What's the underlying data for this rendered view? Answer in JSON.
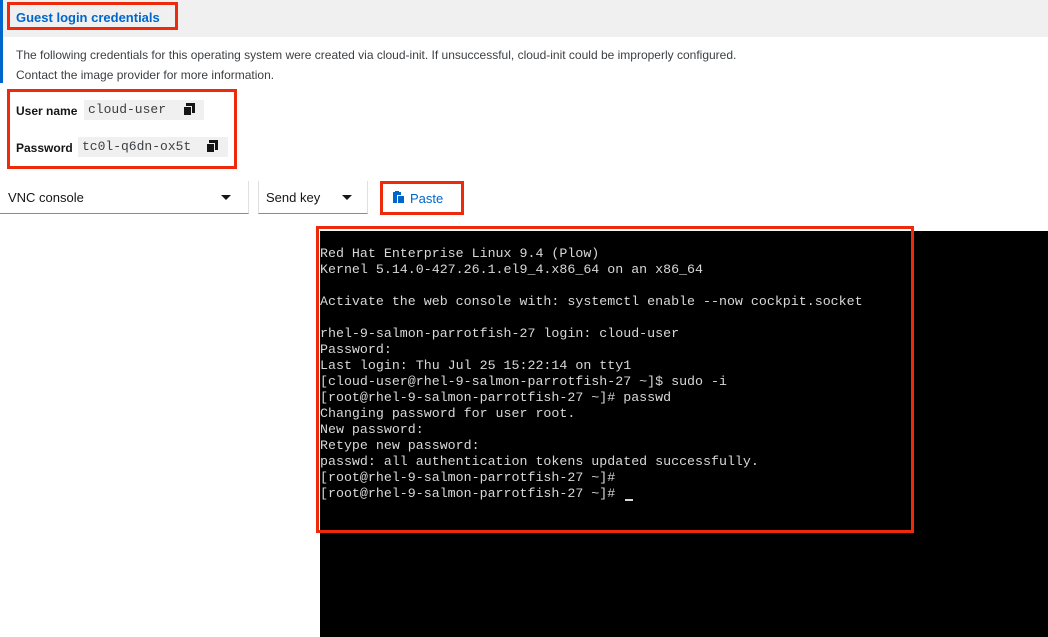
{
  "credentials": {
    "title": "Guest login credentials",
    "description_line1": "The following credentials for this operating system were created via cloud-init. If unsuccessful, cloud-init could be improperly configured.",
    "description_line2": "Contact the image provider for more information.",
    "username_label": "User name",
    "username_value": "cloud-user",
    "password_label": "Password",
    "password_value": "tc0l-q6dn-ox5t",
    "copy_icon": "copy-icon"
  },
  "toolbar": {
    "console_type_selected": "VNC console",
    "send_key_label": "Send key",
    "paste_label": "Paste",
    "paste_icon": "paste-icon"
  },
  "console": {
    "lines": [
      "Red Hat Enterprise Linux 9.4 (Plow)",
      "Kernel 5.14.0-427.26.1.el9_4.x86_64 on an x86_64",
      "",
      "Activate the web console with: systemctl enable --now cockpit.socket",
      "",
      "rhel-9-salmon-parrotfish-27 login: cloud-user",
      "Password:",
      "Last login: Thu Jul 25 15:22:14 on tty1",
      "[cloud-user@rhel-9-salmon-parrotfish-27 ~]$ sudo -i",
      "[root@rhel-9-salmon-parrotfish-27 ~]# passwd",
      "Changing password for user root.",
      "New password:",
      "Retype new password:",
      "passwd: all authentication tokens updated successfully.",
      "[root@rhel-9-salmon-parrotfish-27 ~]#",
      "[root@rhel-9-salmon-parrotfish-27 ~]#"
    ]
  },
  "colors": {
    "accent": "#0066cc",
    "highlight": "#ee2a0c",
    "console_bg": "#000000",
    "console_text": "#d8d8d8"
  }
}
